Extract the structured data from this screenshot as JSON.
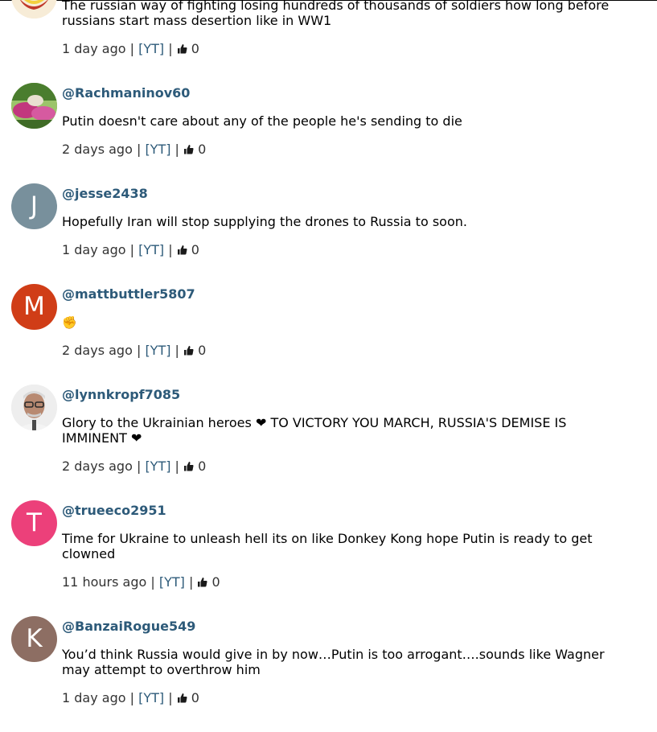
{
  "comments": [
    {
      "username": "",
      "text": "The russian way of fighting losing hundreds of thousands of soldiers how long before russians start mass desertion like in WW1",
      "time": "1 day ago",
      "source_link": "[YT]",
      "likes": "0",
      "avatar": {
        "kind": "image",
        "colors": [
          "#c0392b",
          "#f4d03f",
          "#ffffff"
        ]
      }
    },
    {
      "username": "@Rachmaninov60",
      "text": "Putin doesn't care about any of the people he's sending to die",
      "time": "2 days ago",
      "source_link": "[YT]",
      "likes": "0",
      "avatar": {
        "kind": "image",
        "colors": [
          "#4a7d2e",
          "#c2377e",
          "#8fb05a"
        ]
      }
    },
    {
      "username": "@jesse2438",
      "text": "Hopefully Iran will stop supplying the drones to Russia to soon.",
      "time": "1 day ago",
      "source_link": "[YT]",
      "likes": "0",
      "avatar": {
        "kind": "letter",
        "letter": "J",
        "color": "#78909c"
      }
    },
    {
      "username": "@mattbuttler5807",
      "text": "✊",
      "time": "2 days ago",
      "source_link": "[YT]",
      "likes": "0",
      "avatar": {
        "kind": "letter",
        "letter": "M",
        "color": "#d03d17"
      }
    },
    {
      "username": "@lynnkropf7085",
      "text": "Glory to the Ukrainian heroes ❤ TO VICTORY YOU MARCH, RUSSIA'S DEMISE IS IMMINENT ❤",
      "time": "2 days ago",
      "source_link": "[YT]",
      "likes": "0",
      "avatar": {
        "kind": "image",
        "colors": [
          "#e9e9e9",
          "#7a5a4a",
          "#2b2b2b"
        ]
      }
    },
    {
      "username": "@trueeco2951",
      "text": "Time for Ukraine to unleash hell its on like Donkey Kong hope Putin is ready to get clowned",
      "time": "11 hours ago",
      "source_link": "[YT]",
      "likes": "0",
      "avatar": {
        "kind": "letter",
        "letter": "T",
        "color": "#ec407a"
      }
    },
    {
      "username": "@BanzaiRogue549",
      "text": "You’d think Russia would give in by now…Putin is too arrogant….sounds like Wagner may attempt to overthrow him",
      "time": "1 day ago",
      "source_link": "[YT]",
      "likes": "0",
      "avatar": {
        "kind": "letter",
        "letter": "K",
        "color": "#8d6e63"
      }
    }
  ],
  "separator": " | ",
  "link_color": "#2d5a79"
}
